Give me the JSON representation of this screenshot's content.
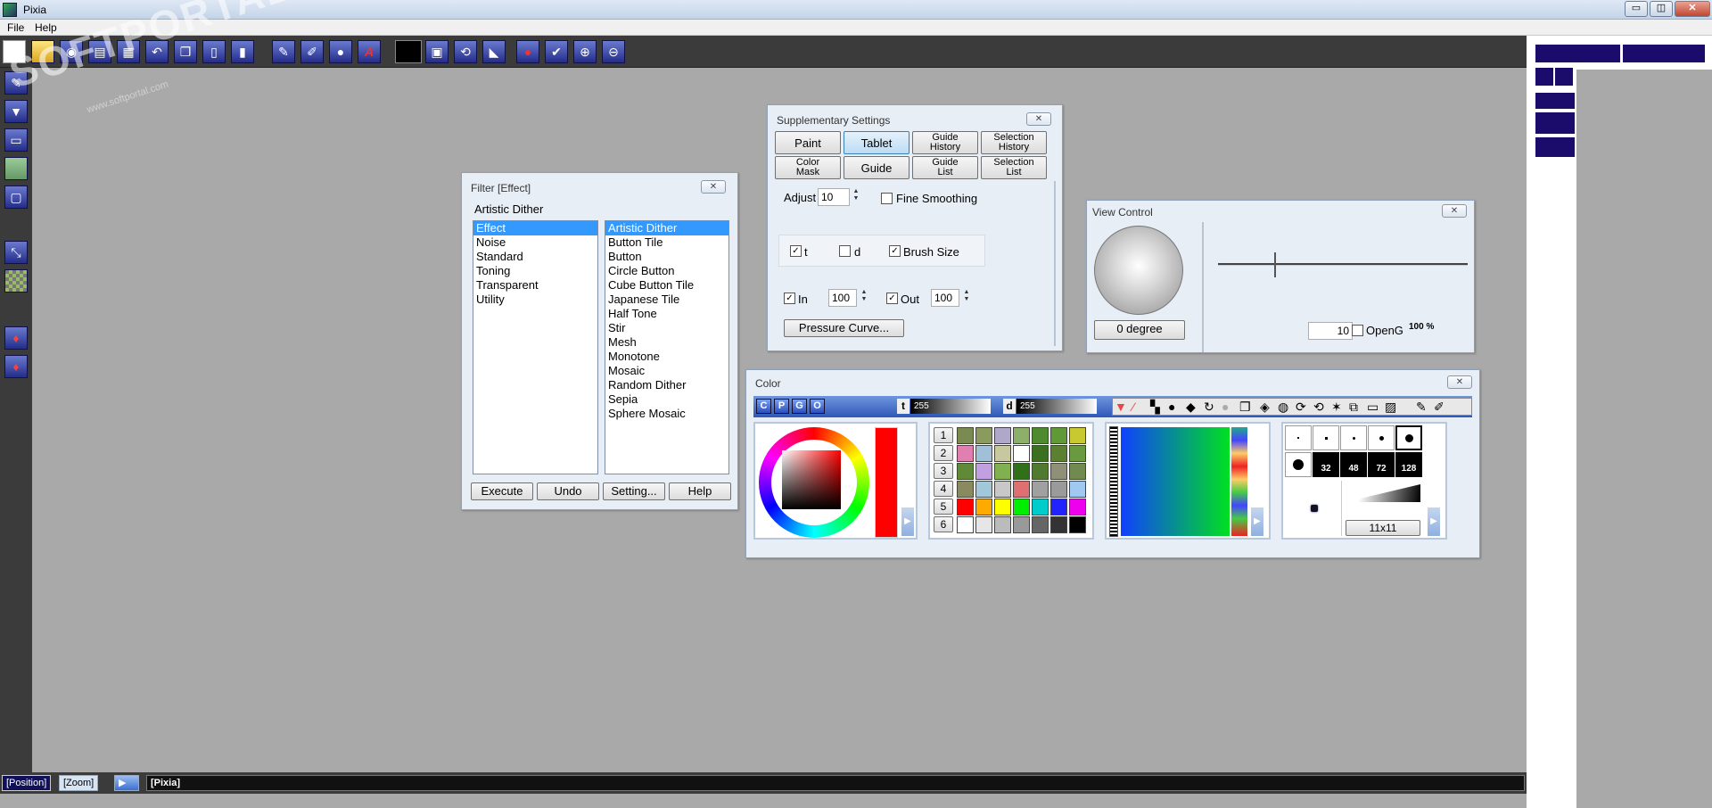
{
  "window": {
    "title": "Pixia",
    "minimize": "▭",
    "restore": "◫",
    "close": "✕"
  },
  "menu": {
    "file": "File",
    "help": "Help"
  },
  "watermark": {
    "brand": "SOFTPORTAL",
    "url": "www.softportal.com"
  },
  "filter": {
    "title": "Filter [Effect]",
    "current": "Artistic Dither",
    "categories": [
      "Effect",
      "Noise",
      "Standard",
      "Toning",
      "Transparent",
      "Utility"
    ],
    "effects": [
      "Artistic Dither",
      "Button Tile",
      "Button",
      "Circle Button",
      "Cube Button Tile",
      "Japanese Tile",
      "Half Tone",
      "Stir",
      "Mesh",
      "Monotone",
      "Mosaic",
      "Random Dither",
      "Sepia",
      "Sphere Mosaic"
    ],
    "buttons": {
      "execute": "Execute",
      "undo": "Undo",
      "setting": "Setting...",
      "help": "Help"
    }
  },
  "supp": {
    "title": "Supplementary Settings",
    "tabs": {
      "paint": "Paint",
      "tablet": "Tablet",
      "guide_history_1": "Guide",
      "guide_history_2": "History",
      "selection_history_1": "Selection",
      "selection_history_2": "History",
      "color_mask_1": "Color",
      "color_mask_2": "Mask",
      "guide": "Guide",
      "guide_list_1": "Guide",
      "guide_list_2": "List",
      "selection_list_1": "Selection",
      "selection_list_2": "List"
    },
    "adjust_label": "Adjust",
    "adjust_value": "10",
    "fine_smoothing": "Fine Smoothing",
    "t_label": "t",
    "d_label": "d",
    "brush_size": "Brush Size",
    "in_label": "In",
    "in_value": "100",
    "out_label": "Out",
    "out_value": "100",
    "pressure_curve": "Pressure Curve...",
    "checked": "✓"
  },
  "view": {
    "title": "View Control",
    "degree_button": "0 degree",
    "zoom_value": "10",
    "opengl_label": "OpenG",
    "percent_label": "100 %"
  },
  "color": {
    "title": "Color",
    "mode_icons": [
      "C",
      "P",
      "G",
      "O"
    ],
    "t_label": "t",
    "t_value": "255",
    "d_label": "d",
    "d_value": "255",
    "palette_rows": [
      "1",
      "2",
      "3",
      "4",
      "5",
      "6"
    ],
    "brush_sizes": [
      "32",
      "48",
      "72",
      "128"
    ],
    "brush_dims": "11x11"
  },
  "status": {
    "position": "[Position]",
    "zoom": "[Zoom]",
    "info": "[Pixia]"
  },
  "colors": {
    "accent": "#1b0b6b",
    "selection": "#3399ff",
    "canvas": "#a9a9a9"
  }
}
